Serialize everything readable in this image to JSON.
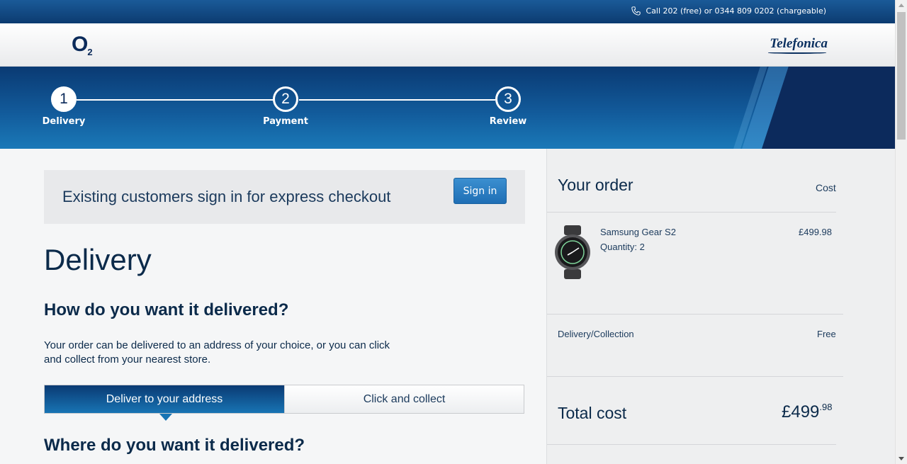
{
  "topbar": {
    "call_text": "Call 202 (free) or 0344 809 0202 (chargeable)",
    "icon": "phone-icon"
  },
  "header": {
    "brand_logo": "O",
    "brand_logo_sub": "2",
    "partner_logo": "Telefonica"
  },
  "progress": {
    "steps": [
      {
        "number": "1",
        "label": "Delivery",
        "active": true
      },
      {
        "number": "2",
        "label": "Payment",
        "active": false
      },
      {
        "number": "3",
        "label": "Review",
        "active": false
      }
    ]
  },
  "signin": {
    "text": "Existing customers sign in for express checkout",
    "button_label": "Sign in"
  },
  "delivery": {
    "title": "Delivery",
    "question": "How do you want it delivered?",
    "description": "Your order can be delivered to an address of your choice, or you can click and collect from your nearest store.",
    "tabs": [
      {
        "label": "Deliver to your address",
        "active": true
      },
      {
        "label": "Click and collect",
        "active": false
      }
    ],
    "where_question": "Where do you want it delivered?"
  },
  "order": {
    "title": "Your order",
    "cost_header": "Cost",
    "item": {
      "name": "Samsung Gear S2",
      "quantity": "Quantity: 2",
      "price": "£499.98",
      "image": "smartwatch-image"
    },
    "delivery_label": "Delivery/Collection",
    "delivery_value": "Free",
    "total_label": "Total cost",
    "total_pounds": "£499",
    "total_pence": ".98"
  },
  "colors": {
    "brand_navy": "#0b2a5a",
    "accent_blue": "#1f6fb5",
    "background": "#f5f6f7"
  }
}
